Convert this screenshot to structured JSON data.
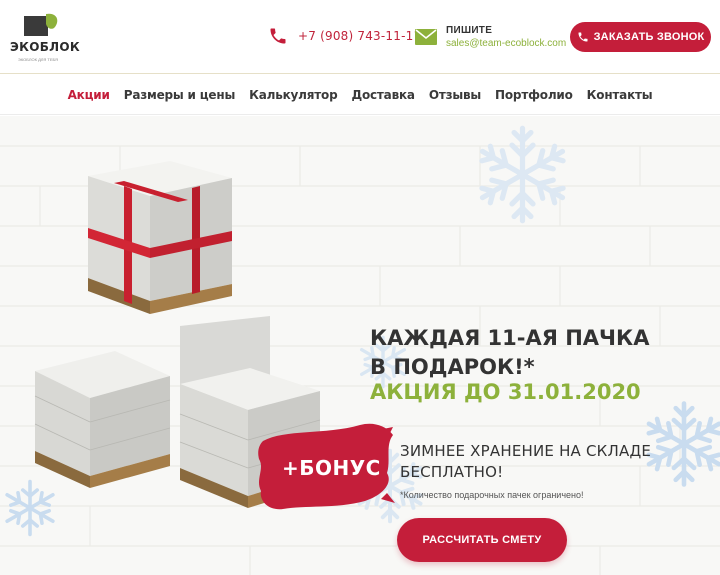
{
  "header": {
    "logo_text": "ЭКОБЛОК",
    "logo_tagline": "ЭКОБЛОК ДЛЯ ТЕБЯ",
    "phone": "+7 (908) 743-11-11",
    "mail_label": "ПИШИТЕ",
    "mail_address": "sales@team-ecoblock.com",
    "call_button": "ЗАКАЗАТЬ ЗВОНОК"
  },
  "nav": {
    "items": [
      {
        "label": "Акции",
        "active": true
      },
      {
        "label": "Размеры и цены"
      },
      {
        "label": "Калькулятор"
      },
      {
        "label": "Доставка"
      },
      {
        "label": "Отзывы"
      },
      {
        "label": "Портфолио"
      },
      {
        "label": "Контакты"
      }
    ]
  },
  "hero": {
    "headline": "КАЖДАЯ 11-АЯ ПАЧКА В ПОДАРОК!*",
    "promo": "АКЦИЯ ДО 31.01.2020",
    "bonus": "+БОНУС",
    "free_storage": "ЗИМНЕЕ ХРАНЕНИЕ НА СКЛАДЕ БЕСПЛАТНО!",
    "note": "*Количество подарочных пачек ограничено!",
    "cta_button": "РАССЧИТАТЬ СМЕТУ"
  },
  "colors": {
    "accent_red": "#c41e3a",
    "accent_green": "#8db13b"
  },
  "icons": [
    "leaf-logo-icon",
    "phone-icon",
    "envelope-icon",
    "snowflake-icon"
  ]
}
